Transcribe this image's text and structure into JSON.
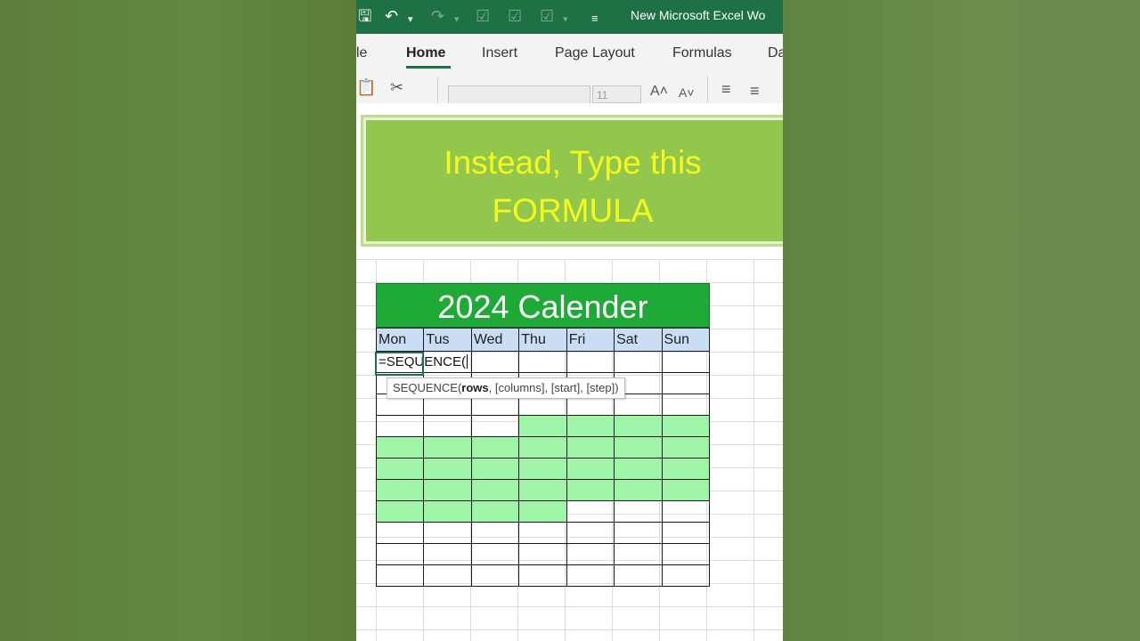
{
  "window": {
    "title": "New Microsoft Excel Wo"
  },
  "quick_access": {
    "save_icon": "save-icon",
    "undo_icon": "undo-icon",
    "redo_icon": "redo-icon"
  },
  "ribbon": {
    "tabs": [
      {
        "label": "le"
      },
      {
        "label": "Home",
        "active": true
      },
      {
        "label": "Insert"
      },
      {
        "label": "Page Layout"
      },
      {
        "label": "Formulas"
      },
      {
        "label": "Da"
      }
    ],
    "font_size": "11"
  },
  "banner": {
    "line1": "Instead, Type this",
    "line2": "FORMULA"
  },
  "calendar": {
    "title": "2024 Calender",
    "days": [
      "Mon",
      "Tus",
      "Wed",
      "Thu",
      "Fri",
      "Sat",
      "Sun"
    ],
    "formula": "=SEQUENCE(",
    "highlighted_rows": [
      [
        false,
        false,
        false,
        true,
        true,
        true,
        true
      ],
      [
        true,
        true,
        true,
        true,
        true,
        true,
        true
      ],
      [
        true,
        true,
        true,
        true,
        true,
        true,
        true
      ],
      [
        true,
        true,
        true,
        true,
        true,
        true,
        true
      ],
      [
        true,
        true,
        true,
        true,
        false,
        false,
        false
      ]
    ]
  },
  "tooltip": {
    "fn": "SEQUENCE(",
    "arg_rows": "rows",
    "rest": ", [columns], [start], [step])"
  },
  "colors": {
    "excel_green": "#1e7145",
    "banner_green": "#92c64d",
    "banner_text": "#f6fa1c",
    "calendar_title_bg": "#1faa37",
    "header_bg": "#c9ddf5",
    "highlight": "#9ef5a8"
  }
}
